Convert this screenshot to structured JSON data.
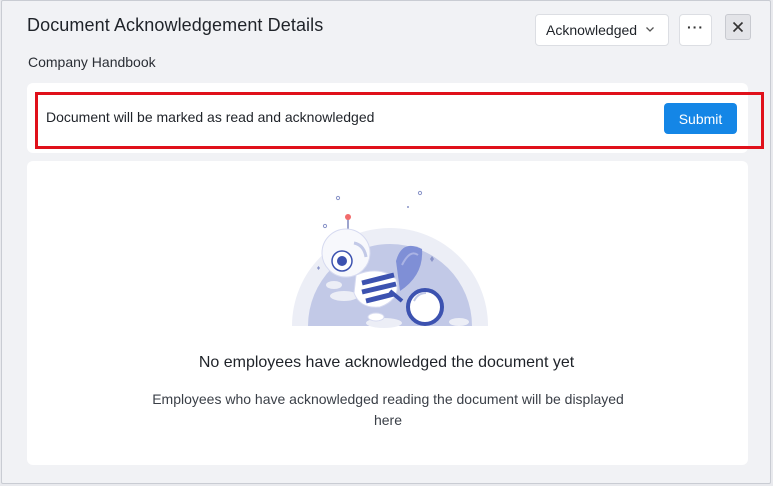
{
  "dialog": {
    "title": "Document Acknowledgement Details",
    "document_name": "Company Handbook",
    "status_dropdown": {
      "selected": "Acknowledged",
      "icon": "chevron-down-icon"
    },
    "more_button": {
      "label": "···",
      "icon": "more-horizontal-icon"
    },
    "close_button": {
      "icon": "close-icon"
    }
  },
  "acknowledge_bar": {
    "message": "Document will be marked as read and acknowledged",
    "submit_label": "Submit",
    "highlight_color": "#e0101a"
  },
  "empty_state": {
    "title": "No employees have acknowledged the document yet",
    "description": "Employees who have acknowledged reading the document will be displayed here",
    "illustration": "robot-with-magnifying-glass"
  },
  "colors": {
    "accent": "#1486e6",
    "background": "#f1f2f5",
    "card": "#ffffff"
  }
}
